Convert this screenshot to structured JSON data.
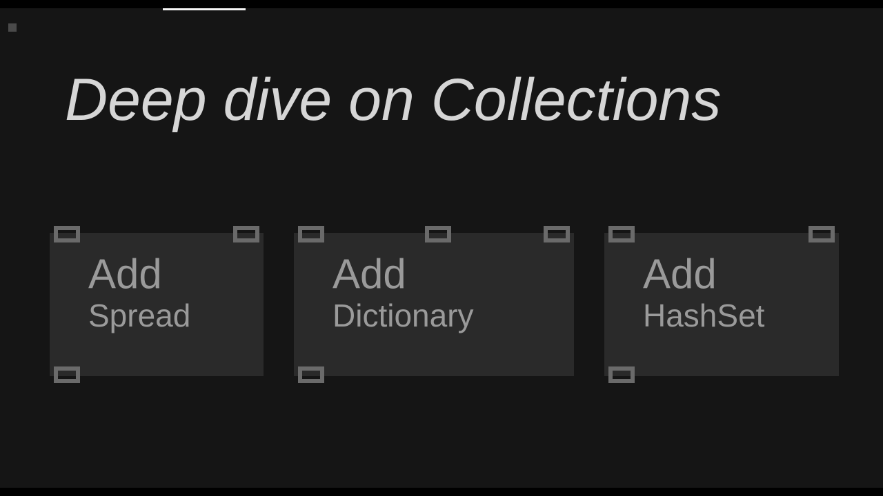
{
  "title": "Deep dive on Collections",
  "nodes": [
    {
      "title": "Add",
      "subtitle": "Spread"
    },
    {
      "title": "Add",
      "subtitle": "Dictionary"
    },
    {
      "title": "Add",
      "subtitle": "HashSet"
    }
  ]
}
